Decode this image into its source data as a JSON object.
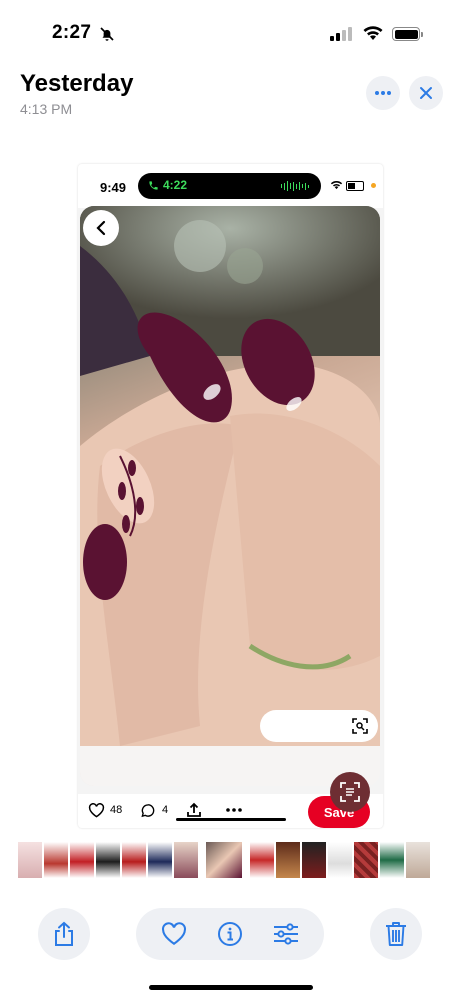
{
  "status_bar": {
    "time": "2:27"
  },
  "header": {
    "title": "Yesterday",
    "subtitle": "4:13 PM"
  },
  "screenshot": {
    "status_time": "9:49",
    "call_time": "4:22",
    "likes": "48",
    "comments": "4",
    "save_label": "Save"
  },
  "thumbnail_strip": {
    "count": 16,
    "selected_index": 7
  },
  "colors": {
    "accent_blue": "#2c7be5",
    "pinterest_red": "#e60023",
    "nail_plum": "#5a1232",
    "call_green": "#3ddc5c"
  },
  "icons": [
    "bell-slash-icon",
    "ellipsis-icon",
    "close-icon",
    "back-chevron-icon",
    "heart-icon",
    "comment-icon",
    "share-icon",
    "visual-search-icon",
    "lens-icon",
    "trash-icon",
    "info-icon",
    "adjust-icon"
  ]
}
